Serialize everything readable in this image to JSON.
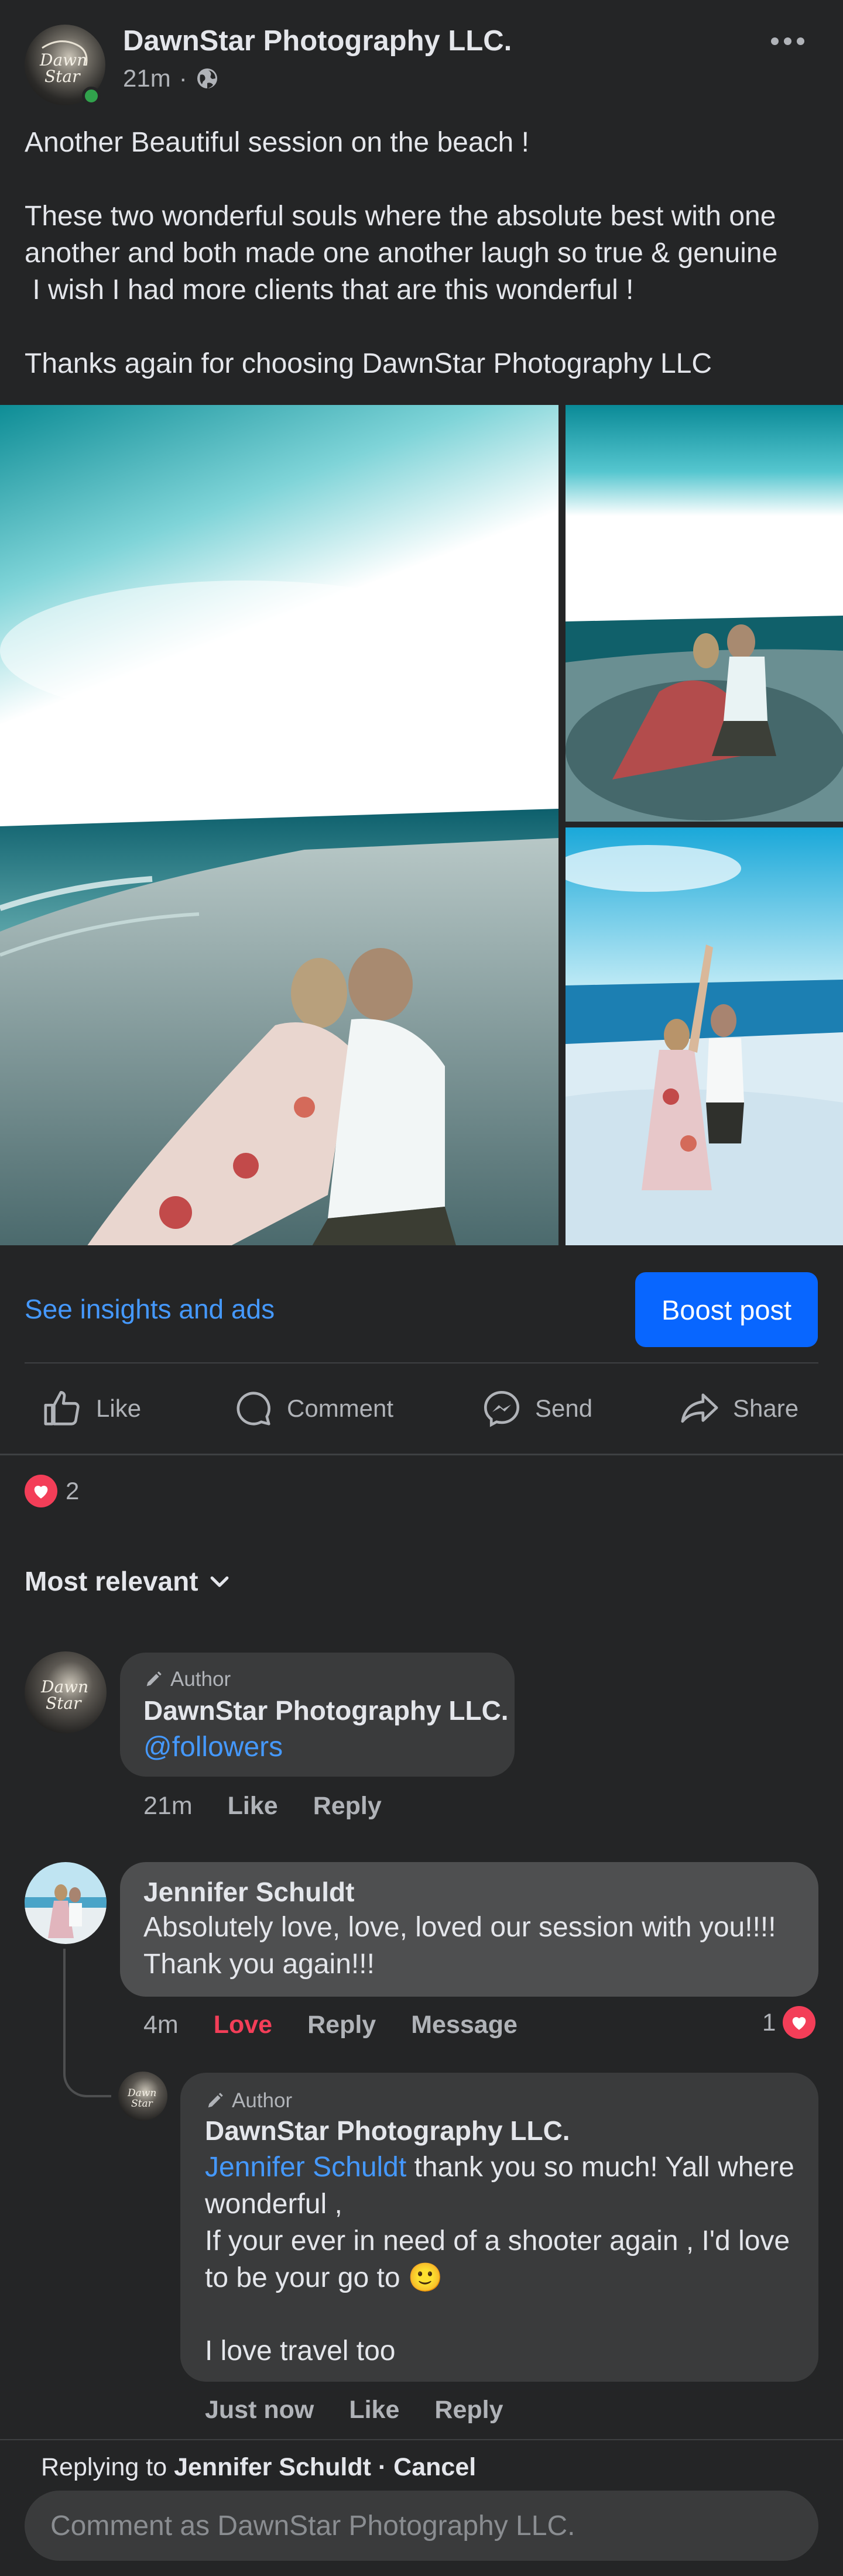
{
  "post": {
    "page_name": "DawnStar Photography LLC.",
    "time": "21m",
    "dot": "·",
    "text": "Another Beautiful session on the beach !\n\nThese two wonderful souls where the absolute best with one another and both made one another laugh so true & genuine\n I wish I had more clients that are this wonderful !\n\nThanks again for choosing DawnStar Photography LLC",
    "avatar_text": "Dawn\nStar"
  },
  "actions": {
    "insights": "See insights and ads",
    "boost": "Boost post",
    "like": "Like",
    "comment": "Comment",
    "send": "Send",
    "share": "Share"
  },
  "reactions": {
    "count": "2"
  },
  "sort": {
    "label": "Most relevant"
  },
  "comments": [
    {
      "badge": "Author",
      "name": "DawnStar Photography LLC.",
      "mention": "@followers",
      "time": "21m",
      "like": "Like",
      "reply": "Reply"
    },
    {
      "name": "Jennifer Schuldt",
      "text": "Absolutely love, love, loved our session with you!!!! Thank you again!!!",
      "time": "4m",
      "reaction": "Love",
      "reply": "Reply",
      "message": "Message",
      "reaction_count": "1"
    }
  ],
  "reply": {
    "badge": "Author",
    "name": "DawnStar Photography LLC.",
    "mention": "Jennifer Schuldt",
    "text_1": " thank you so much! Yall where wonderful ,",
    "text_2": "If your ever in need of a shooter again , I'd love to be your go to 🙂",
    "text_3": "I love travel too",
    "time": "Just now",
    "like": "Like",
    "reply": "Reply"
  },
  "composer": {
    "replying_prefix": "Replying to ",
    "replying_name": "Jennifer Schuldt",
    "cancel": " · Cancel",
    "placeholder": "Comment as DawnStar Photography LLC."
  }
}
